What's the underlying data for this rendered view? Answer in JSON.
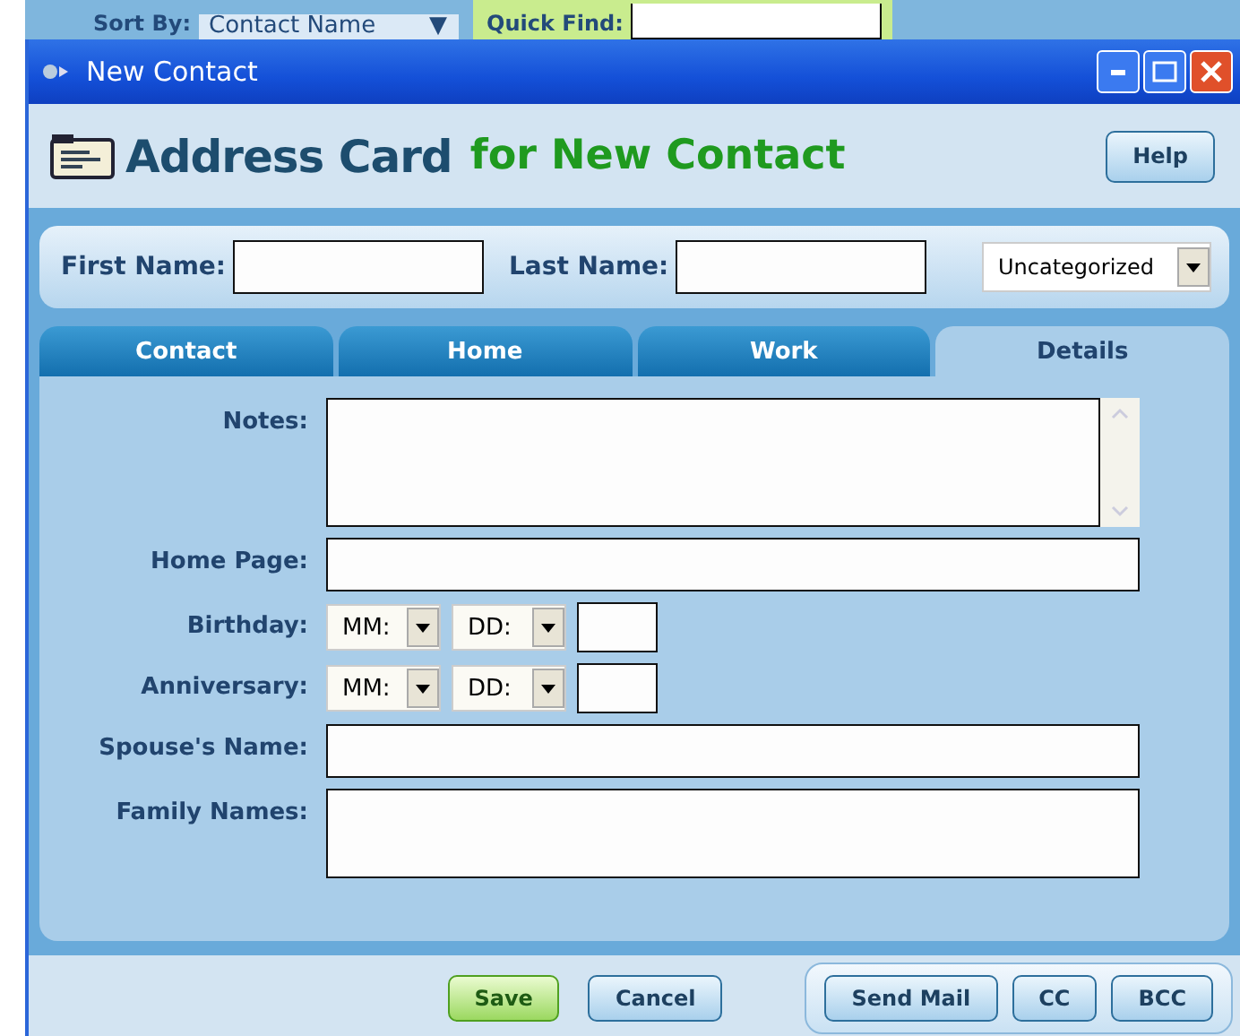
{
  "background_bar": {
    "sort_label": "Sort By:",
    "sort_value": "Contact Name",
    "sort_caret": "▼",
    "quick_find_label": "Quick Find:"
  },
  "window": {
    "title": "New Contact"
  },
  "header": {
    "title": "Address Card",
    "subtitle": "for New Contact",
    "help": "Help"
  },
  "name_bar": {
    "first_label": "First Name:",
    "last_label": "Last Name:",
    "category": "Uncategorized"
  },
  "tabs": [
    {
      "label": "Contact",
      "selected": false
    },
    {
      "label": "Home",
      "selected": false
    },
    {
      "label": "Work",
      "selected": false
    },
    {
      "label": "Details",
      "selected": true
    }
  ],
  "fields": [
    {
      "label": "Notes:",
      "kind": "notes"
    },
    {
      "label": "Home Page:",
      "kind": "text"
    },
    {
      "label": "Birthday:",
      "kind": "date",
      "month": "MM:",
      "day": "DD:"
    },
    {
      "label": "Anniversary:",
      "kind": "date",
      "month": "MM:",
      "day": "DD:"
    },
    {
      "label": "Spouse's Name:",
      "kind": "text"
    },
    {
      "label": "Family Names:",
      "kind": "area"
    }
  ],
  "buttons": {
    "save": "Save",
    "cancel": "Cancel",
    "mail": [
      "Send Mail",
      "CC",
      "BCC"
    ]
  }
}
